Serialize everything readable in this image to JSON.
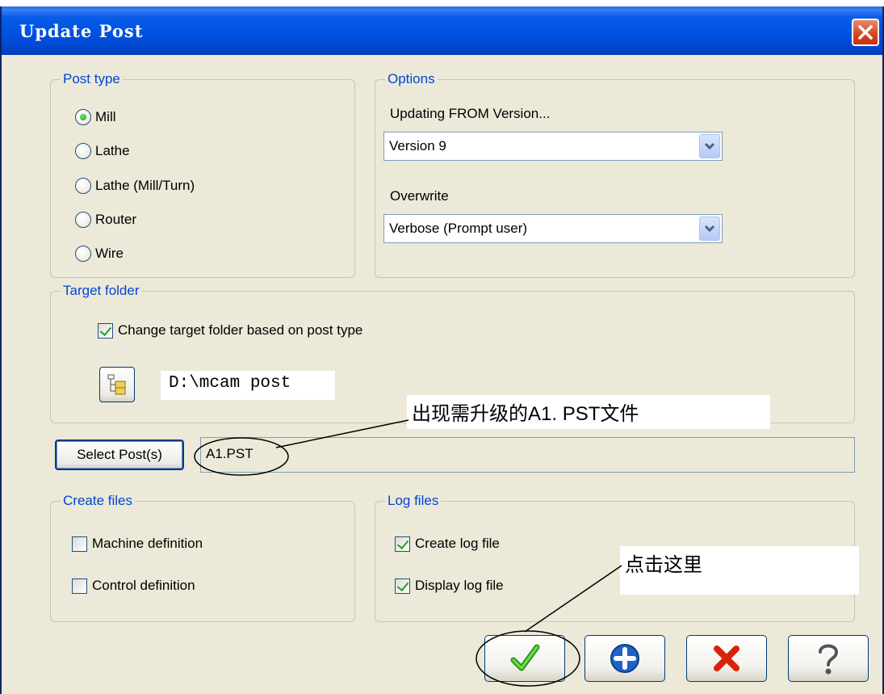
{
  "window": {
    "title": "Update Post"
  },
  "post_type": {
    "legend": "Post type",
    "options": [
      {
        "label": "Mill",
        "selected": true
      },
      {
        "label": "Lathe",
        "selected": false
      },
      {
        "label": "Lathe (Mill/Turn)",
        "selected": false
      },
      {
        "label": "Router",
        "selected": false
      },
      {
        "label": "Wire",
        "selected": false
      }
    ]
  },
  "options": {
    "legend": "Options",
    "from_label": "Updating FROM Version...",
    "from_value": "Version 9",
    "overwrite_label": "Overwrite",
    "overwrite_value": "Verbose (Prompt user)"
  },
  "target_folder": {
    "legend": "Target folder",
    "change_label": "Change target folder based on post type",
    "change_checked": true,
    "path": "D:\\mcam post"
  },
  "select_posts": {
    "button_label": "Select Post(s)",
    "value": "A1.PST"
  },
  "create_files": {
    "legend": "Create files",
    "items": [
      {
        "label": "Machine definition",
        "checked": false
      },
      {
        "label": "Control definition",
        "checked": false
      }
    ]
  },
  "log_files": {
    "legend": "Log files",
    "items": [
      {
        "label": "Create log file",
        "checked": true
      },
      {
        "label": "Display log file",
        "checked": true
      }
    ]
  },
  "annotations": {
    "found_file": "出现需升级的A1. PST文件",
    "click_here": "点击这里"
  },
  "icons": {
    "close": "close-icon",
    "folder": "folder-tree-icon",
    "ok": "checkmark-icon",
    "add": "plus-icon",
    "cancel": "x-icon",
    "help": "help-icon"
  },
  "colors": {
    "title_bar": "#0054e3",
    "legend_text": "#0046d5",
    "dialog_bg": "#ece9d8"
  }
}
